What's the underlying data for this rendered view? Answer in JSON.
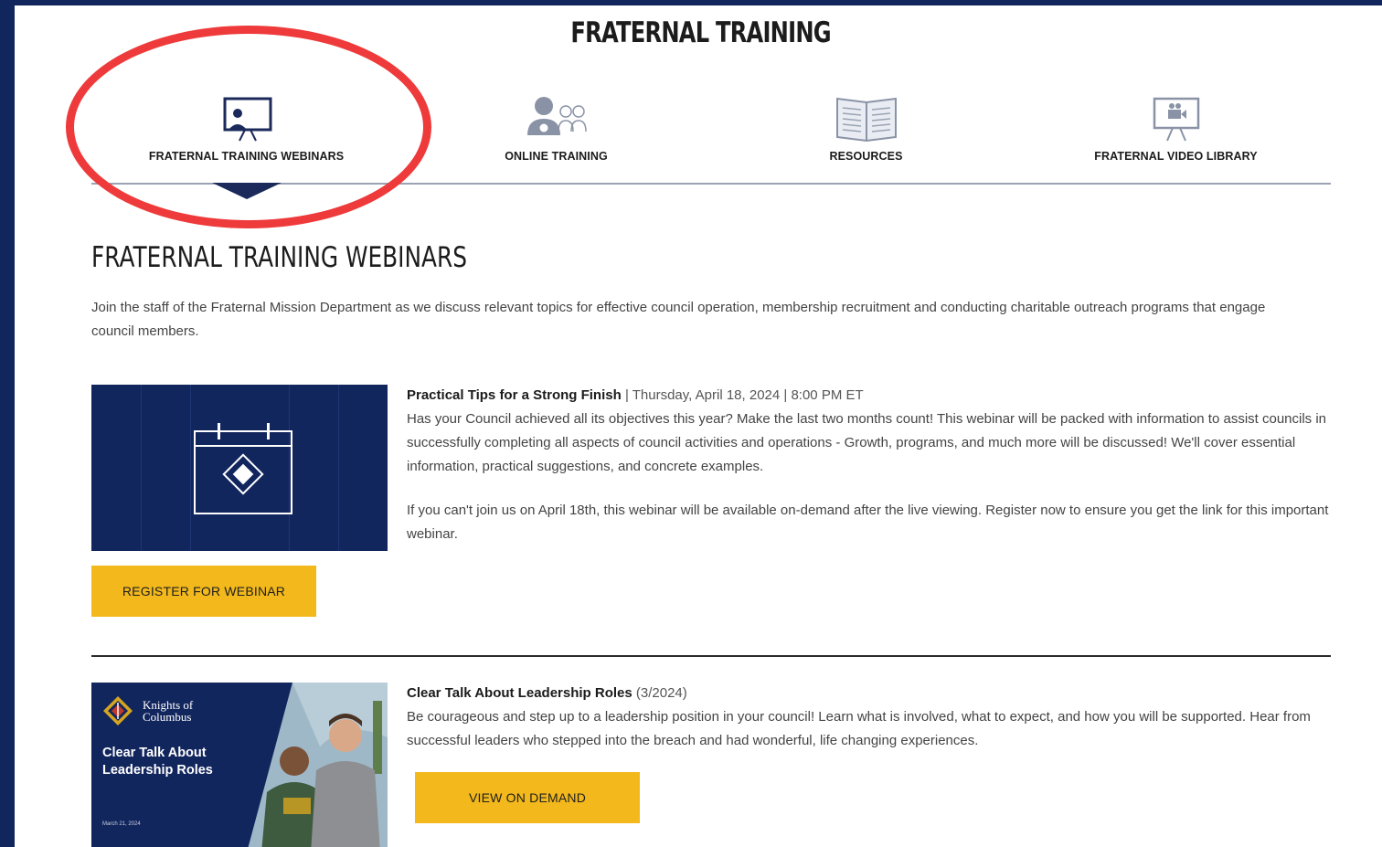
{
  "page": {
    "title": "FRATERNAL TRAINING"
  },
  "tabs": [
    {
      "label": "FRATERNAL TRAINING WEBINARS",
      "icon": "presentation-screen-icon",
      "active": true
    },
    {
      "label": "ONLINE TRAINING",
      "icon": "people-group-icon",
      "active": false
    },
    {
      "label": "RESOURCES",
      "icon": "open-book-icon",
      "active": false
    },
    {
      "label": "FRATERNAL VIDEO LIBRARY",
      "icon": "video-screen-icon",
      "active": false
    }
  ],
  "section": {
    "title": "FRATERNAL TRAINING WEBINARS",
    "intro": "Join the staff of the Fraternal Mission Department as we discuss relevant topics for effective council operation, membership recruitment and conducting charitable outreach programs that engage council members."
  },
  "webinars": [
    {
      "title": "Practical Tips for a Strong Finish",
      "meta": " | Thursday, April 18, 2024 | 8:00 PM ET",
      "description": "Has your Council achieved all its objectives this year? Make the last two months count! This webinar will be packed with information to assist councils in successfully completing all aspects of council activities and operations - Growth, programs, and much more will be discussed! We'll cover essential information, practical suggestions, and concrete examples.",
      "note": "If you can't join us on April 18th, this webinar will be available on-demand after the live viewing. Register now to ensure you get the link for this important webinar.",
      "button_label": "REGISTER FOR WEBINAR"
    },
    {
      "title": "Clear Talk About Leadership Roles",
      "meta": " (3/2024)",
      "description": "Be courageous and step up to a leadership position in your council! Learn what is involved, what to expect, and how you will be supported. Hear from successful leaders who stepped into the breach and had wonderful, life changing experiences.",
      "button_label": "VIEW ON DEMAND",
      "thumbnail": {
        "brand": "Knights of\nColumbus",
        "title": "Clear Talk About\nLeadership Roles",
        "date": "March 21, 2024"
      }
    }
  ],
  "colors": {
    "frame": "#12265e",
    "button": "#f2b81c",
    "highlight": "#ee3a3a",
    "active_pointer": "#1b2a5a"
  }
}
